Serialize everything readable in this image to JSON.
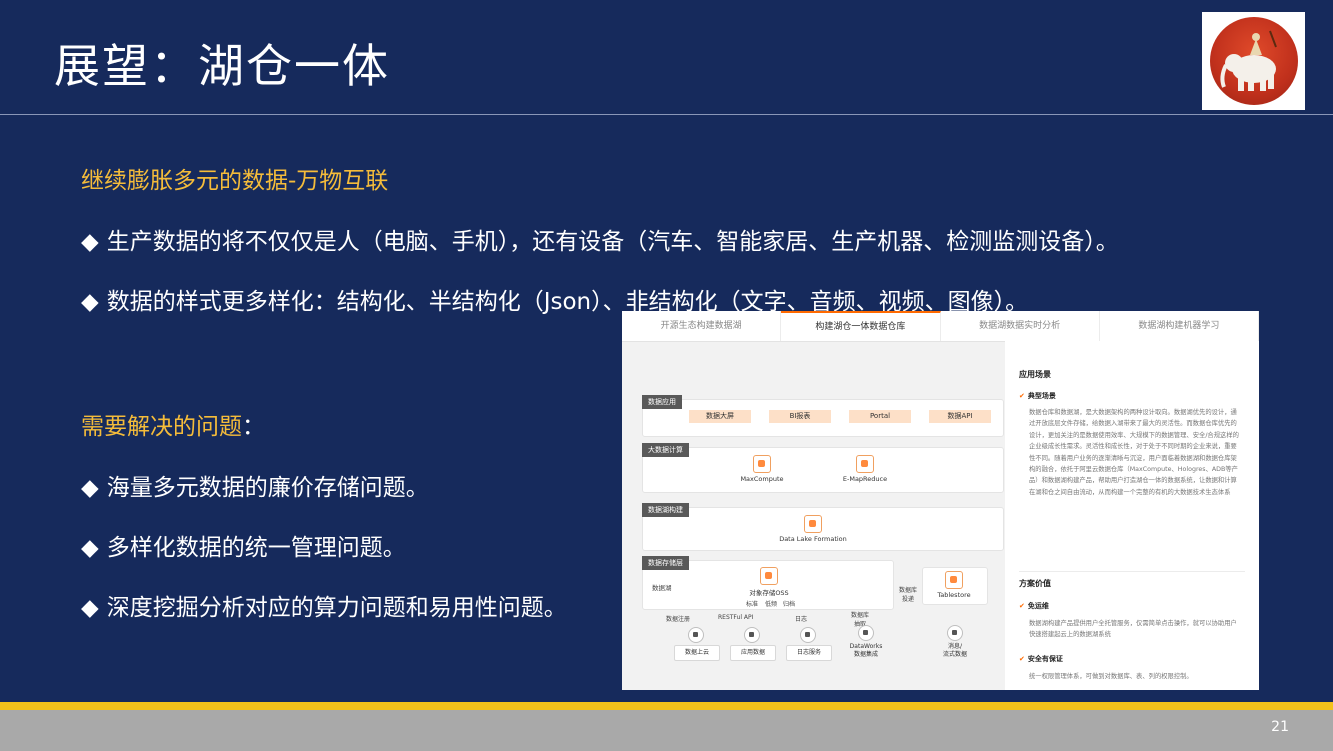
{
  "slide": {
    "title": "展望：湖仓一体",
    "heading1": "继续膨胀多元的数据-万物互联",
    "bullets1": [
      "生产数据的将不仅仅是人（电脑、手机），还有设备（汽车、智能家居、生产机器、检测监测设备）。",
      "数据的样式更多样化：结构化、半结构化（Json）、非结构化（文字、音频、视频、图像）。"
    ],
    "heading2": "需要解决的问题",
    "heading2_colon": "：",
    "bullets2": [
      "海量多元数据的廉价存储问题。",
      "多样化数据的统一管理问题。",
      "深度挖掘分析对应的算力问题和易用性问题。"
    ],
    "bullet_marker": "◆",
    "page_number": "21",
    "colors": {
      "background": "#162a5c",
      "heading": "#f5bc3a",
      "bottom_bar": "#f2c21b",
      "footer": "#a9a9a9"
    }
  },
  "screenshot": {
    "tabs": [
      "开源生态构建数据湖",
      "构建湖仓一体数据仓库",
      "数据湖数据实时分析",
      "数据湖构建机器学习"
    ],
    "active_tab": 1,
    "diagram": {
      "layers": [
        "数据应用",
        "大数据计算",
        "数据湖构建",
        "数据存储层"
      ],
      "apps": [
        "数据大屏",
        "BI报表",
        "Portal",
        "数据API"
      ],
      "compute": [
        "MaxCompute",
        "E-MapReduce"
      ],
      "formation": "Data Lake Formation",
      "storage_label": "数据湖",
      "oss": "对象存储OSS",
      "oss_sub": [
        "标准",
        "低频",
        "归档"
      ],
      "db_load": "数据库\n投递",
      "tablestore": "Tablestore",
      "ingest_labels": [
        "数据注册",
        "RESTFul API",
        "日志",
        "数据库\n抽取"
      ],
      "sources": [
        "数据上云",
        "应用数据",
        "日志服务",
        "DataWorks\n数据集成",
        "消息/\n流式数据"
      ]
    },
    "right": {
      "section1": "应用场景",
      "sub1": "典型场景",
      "body1": "数据仓库和数据湖，是大数据架构的两种设计取向。数据湖优先的设计，通过开放底层文件存储，给数据入湖带来了最大的灵活性。而数据仓库优先的设计，更加关注的是数据使用效率、大规模下的数据管理、安全/合规这样的企业级成长性需求。灵活性和成长性，对于处于不同时期的企业来说，重要性不同。随着用户业务的逐渐清晰与沉淀，用户面临着数据湖和数据仓库架构的融合，依托于阿里云数据仓库（MaxCompute、Hologres、ADB等产品）和数据湖构建产品，帮助用户打造湖仓一体的数据系统，让数据和计算在湖和仓之间自由流动，从而构建一个完整的有机的大数据技术生态体系",
      "section2": "方案价值",
      "sub2": "免运维",
      "body2": "数据湖构建产品提供用户全托管服务，仅需简单点击操作，就可以协助用户快速搭建起云上的数据湖系统",
      "sub3": "安全有保证",
      "body3": "统一权限管理体系，可做到对数据库、表、列的权限控制。",
      "check": "✔"
    }
  }
}
